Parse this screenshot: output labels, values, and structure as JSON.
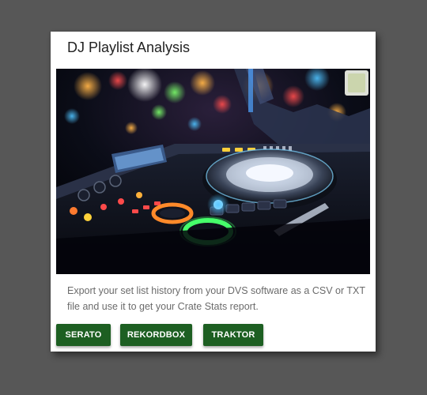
{
  "card": {
    "title": "DJ Playlist Analysis",
    "image_alt": "DJ controller turntable under club lights",
    "description": "Export your set list history from your DVS software as a CSV or TXT file and use it to get your Crate Stats report."
  },
  "actions": [
    {
      "label": "SERATO"
    },
    {
      "label": "REKORDBOX"
    },
    {
      "label": "TRAKTOR"
    }
  ],
  "colors": {
    "page_background": "#575757",
    "card_background": "#ffffff",
    "button_background": "#1d5f22",
    "button_text": "#ffffff",
    "title_text": "#222222",
    "body_text": "#6b6b6b"
  }
}
